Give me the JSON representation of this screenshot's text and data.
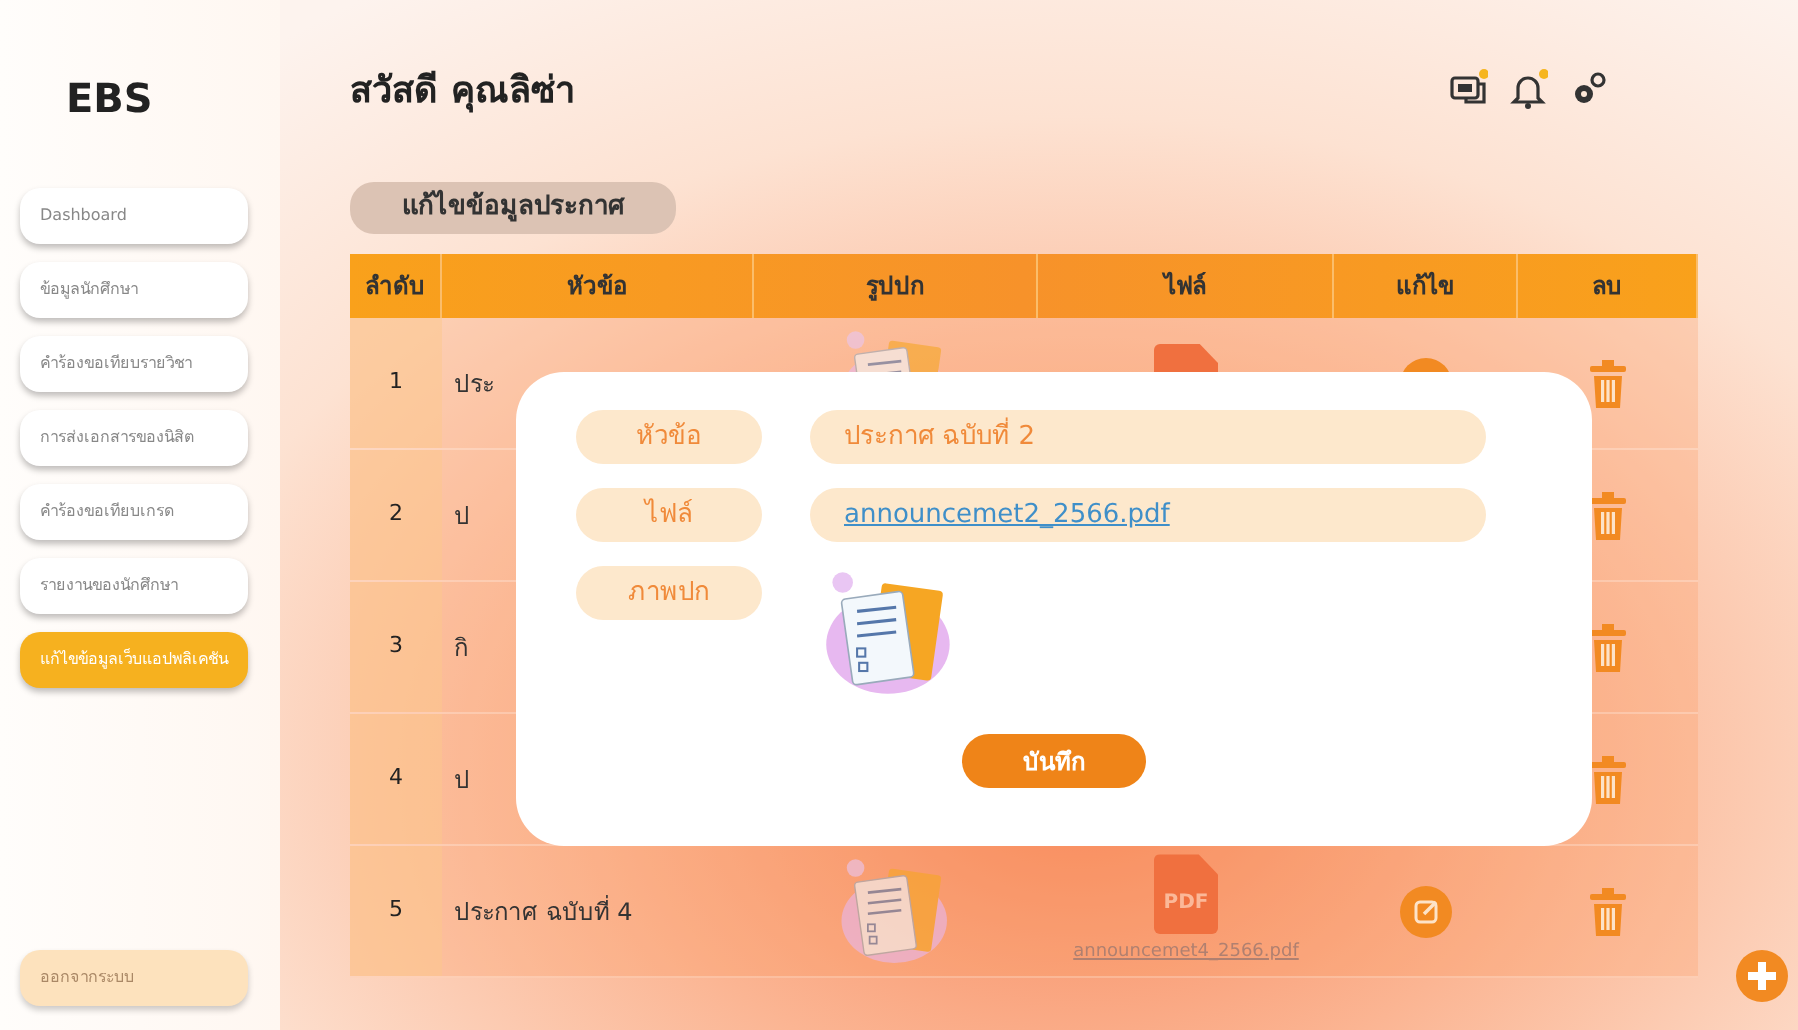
{
  "logo": "EBS",
  "greeting": "สวัสดี คุณลิซ่า",
  "header_icons": [
    {
      "kind": "chat",
      "badge": true
    },
    {
      "kind": "bell",
      "badge": true
    },
    {
      "kind": "gears",
      "badge": false
    }
  ],
  "sidebar": {
    "items": [
      {
        "label": "Dashboard",
        "selected": false
      },
      {
        "label": "ข้อมูลนักศึกษา",
        "selected": false
      },
      {
        "label": "คำร้องขอเทียบรายวิชา",
        "selected": false
      },
      {
        "label": "การส่งเอกสารของนิสิต",
        "selected": false
      },
      {
        "label": "คำร้องขอเทียบเกรด",
        "selected": false
      },
      {
        "label": "รายงานของนักศึกษา",
        "selected": false
      },
      {
        "label": "แก้ไขข้อมูลเว็บแอปพลิเคชัน",
        "selected": true
      }
    ],
    "logout": "ออกจากระบบ"
  },
  "page_title": "แก้ไขข้อมูลประกาศ",
  "table": {
    "columns": [
      "ลำดับ",
      "หัวข้อ",
      "รูปปก",
      "ไฟล์",
      "แก้ไข",
      "ลบ"
    ],
    "rows": [
      {
        "index": "1",
        "title": "ประ",
        "icons": true
      },
      {
        "index": "2",
        "title": "ป"
      },
      {
        "index": "3",
        "title": "กิ"
      },
      {
        "index": "4",
        "title": "ป"
      },
      {
        "index": "5",
        "title": "ประกาศ ฉบับที่ 4",
        "icons": true,
        "pdf_label": "PDF",
        "file": "announcemet4_2566.pdf"
      }
    ]
  },
  "modal": {
    "fields": [
      {
        "label": "หัวข้อ",
        "kind": "text",
        "value": "ประกาศ ฉบับที่ 2"
      },
      {
        "label": "ไฟล์",
        "kind": "link",
        "value": "announcemet2_2566.pdf"
      },
      {
        "label": "ภาพปก",
        "kind": "image"
      }
    ],
    "save": "บันทึก"
  }
}
